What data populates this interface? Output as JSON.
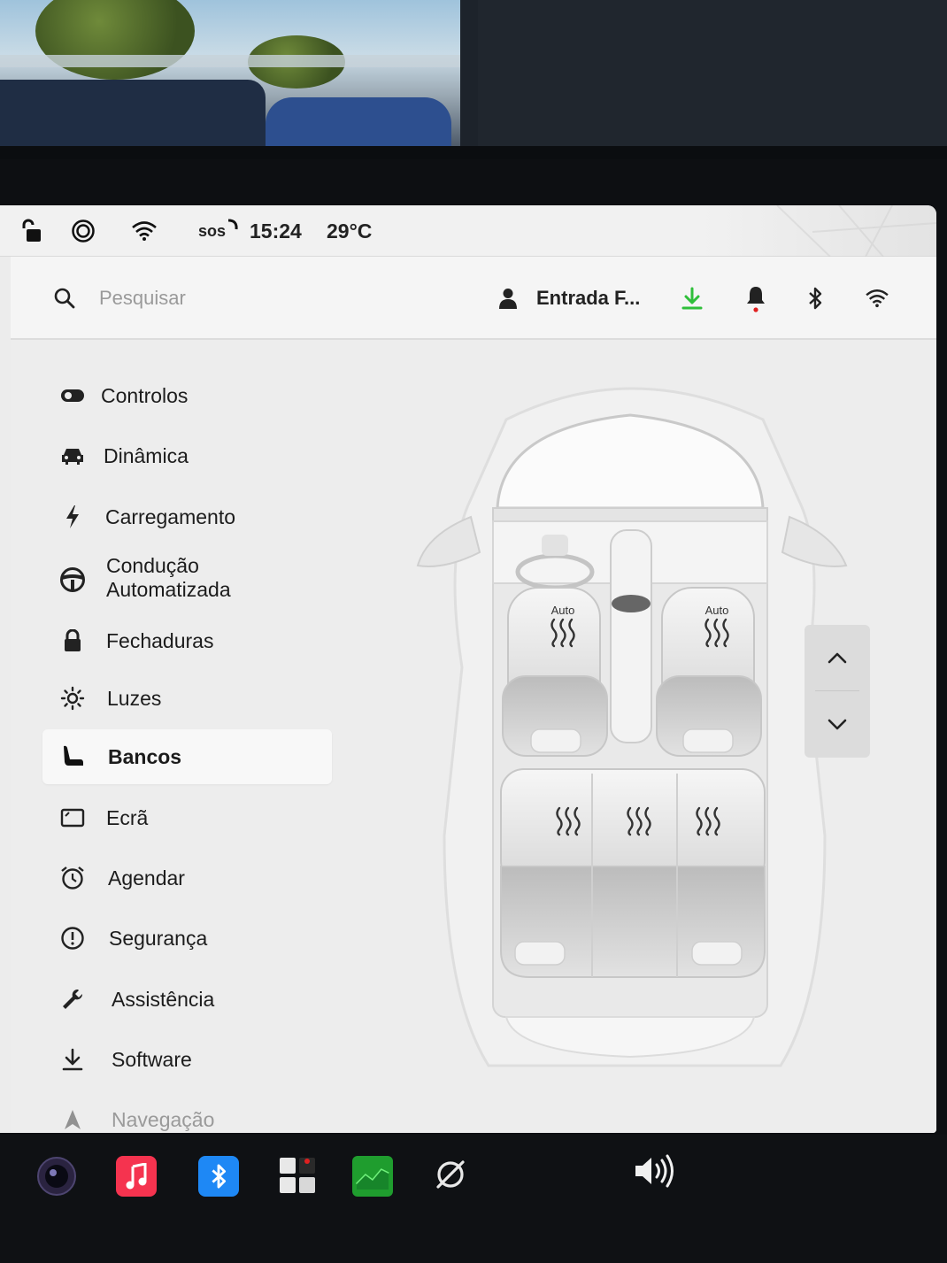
{
  "status_bar": {
    "icons": [
      "lock-open-icon",
      "dashcam-icon",
      "wifi-icon",
      "sos-icon"
    ],
    "sos_label": "SOS",
    "time": "15:24",
    "temperature": "29°C"
  },
  "header": {
    "search_placeholder": "Pesquisar",
    "profile_name": "Entrada F...",
    "icons": [
      "search-icon",
      "profile-icon",
      "download-icon",
      "bell-icon",
      "bluetooth-icon",
      "wifi-icon"
    ],
    "colors": {
      "download": "#2fbf3a",
      "bell_dot": "#e02020"
    }
  },
  "sidebar": {
    "active": "Bancos",
    "items": [
      {
        "label": "Controlos",
        "icon": "toggle-icon"
      },
      {
        "label": "Dinâmica",
        "icon": "car-icon"
      },
      {
        "label": "Carregamento",
        "icon": "bolt-icon"
      },
      {
        "label": "Condução",
        "label2": "Automatizada",
        "icon": "steering-wheel-icon"
      },
      {
        "label": "Fechaduras",
        "icon": "lock-icon"
      },
      {
        "label": "Luzes",
        "icon": "sun-icon"
      },
      {
        "label": "Bancos",
        "icon": "seat-icon"
      },
      {
        "label": "Ecrã",
        "icon": "screen-icon"
      },
      {
        "label": "Agendar",
        "icon": "alarm-clock-icon"
      },
      {
        "label": "Segurança",
        "icon": "alert-circle-icon"
      },
      {
        "label": "Assistência",
        "icon": "wrench-icon"
      },
      {
        "label": "Software",
        "icon": "download-icon"
      },
      {
        "label": "Navegação",
        "icon": "navigation-icon"
      }
    ]
  },
  "seats": {
    "front_left": {
      "label": "Auto",
      "icon": "seat-heat-icon"
    },
    "front_right": {
      "label": "Auto",
      "icon": "seat-heat-icon"
    },
    "rear": [
      "seat-heat-icon",
      "seat-heat-icon",
      "seat-heat-icon"
    ]
  },
  "dock": {
    "items": [
      "camera-icon",
      "music-icon",
      "bluetooth-icon",
      "apps-icon",
      "stocks-icon",
      "sync-off-icon",
      "volume-icon"
    ],
    "colors": {
      "music": "#f5334f",
      "bluetooth": "#1e88f5",
      "stocks": "#1f9d2e"
    }
  }
}
